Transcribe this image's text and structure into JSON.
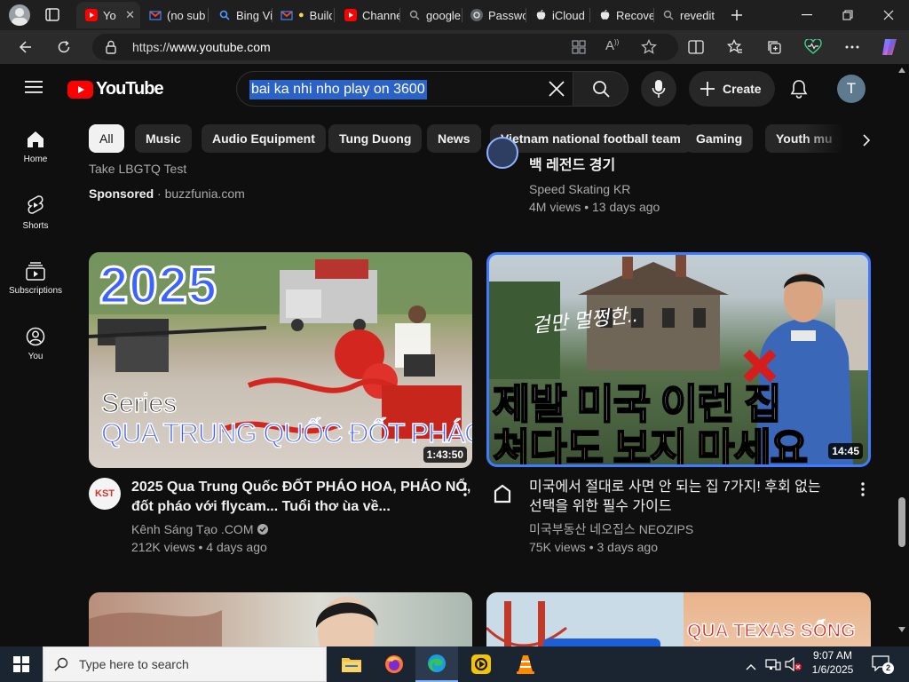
{
  "browser": {
    "tabs": [
      {
        "label": "Yo",
        "icon": "youtube-icon",
        "active": true
      },
      {
        "label": "(no sub",
        "icon": "gmail-icon"
      },
      {
        "label": "Bing Vi",
        "icon": "search-icon"
      },
      {
        "label": "Build",
        "icon": "gmail-icon"
      },
      {
        "label": "Channe",
        "icon": "youtube-icon"
      },
      {
        "label": "google",
        "icon": "search-icon"
      },
      {
        "label": "Passwo",
        "icon": "password-icon"
      },
      {
        "label": "iCloud",
        "icon": "apple-icon"
      },
      {
        "label": "Recove",
        "icon": "apple-icon"
      },
      {
        "label": "revedit",
        "icon": "search-icon"
      }
    ],
    "url_prefix": "https://",
    "url_domain": "www.youtube.com",
    "reader_label": "A"
  },
  "youtube": {
    "logo_text": "YouTube",
    "search_value": "bai ka nhi nho play on 3600",
    "create_label": "Create",
    "avatar_letter": "T",
    "chips": [
      "All",
      "Music",
      "Audio Equipment",
      "Tung Duong",
      "News",
      "Vietnam national football team",
      "Gaming",
      "Youth mu"
    ],
    "guide": [
      {
        "label": "Home",
        "icon": "home-icon"
      },
      {
        "label": "Shorts",
        "icon": "shorts-icon"
      },
      {
        "label": "Subscriptions",
        "icon": "subscriptions-icon"
      },
      {
        "label": "You",
        "icon": "you-icon"
      }
    ],
    "sponsored": {
      "line": "Take LBGTQ Test",
      "label": "Sponsored",
      "separator": " · ",
      "domain": "buzzfunia.com"
    },
    "top_right": {
      "title_partial": "백 레전드 경기",
      "channel": "Speed Skating KR",
      "meta": "4M views • 13 days ago"
    },
    "videos": [
      {
        "thumb_big_text": "2025",
        "thumb_series_text": "Series",
        "thumb_caption": "QUA TRUNG QUỐC ĐỐT PHÁO",
        "duration": "1:43:50",
        "title_line1": "2025 Qua Trung Quốc ĐỐT PHÁO HOA, PHÁO NỔ,",
        "title_line2": "đốt pháo với flycam... Tuổi thơ ùa về...",
        "channel": "Kênh Sáng Tạo .COM",
        "meta": "212K views • 4 days ago",
        "avatar_text": "KST"
      },
      {
        "thumb_script_text": "겉만 멀쩡한..",
        "thumb_line1": "제발 미국 이런 집",
        "thumb_line2": "쳐다도 보지 마세요",
        "duration": "14:45",
        "title_line1": "미국에서 절대로 사면 안 되는 집 7가지! 후회 없는",
        "title_line2": "선택을 위한 필수 가이드",
        "channel": "미국부동산 네오집스 NEOZIPS",
        "meta": "75K views • 3 days ago"
      }
    ],
    "bottom_right_thumb_text": "QUA TEXAS SỐNG"
  },
  "taskbar": {
    "search_placeholder": "Type here to search",
    "time": "9:07 AM",
    "date": "1/6/2025",
    "notification_count": "2"
  },
  "colors": {
    "youtube_red": "#ff0000",
    "selection_blue": "#2b62c7",
    "thumb_caption_blue": "#3d5bff",
    "thumb_yellow": "#ffe01b"
  }
}
